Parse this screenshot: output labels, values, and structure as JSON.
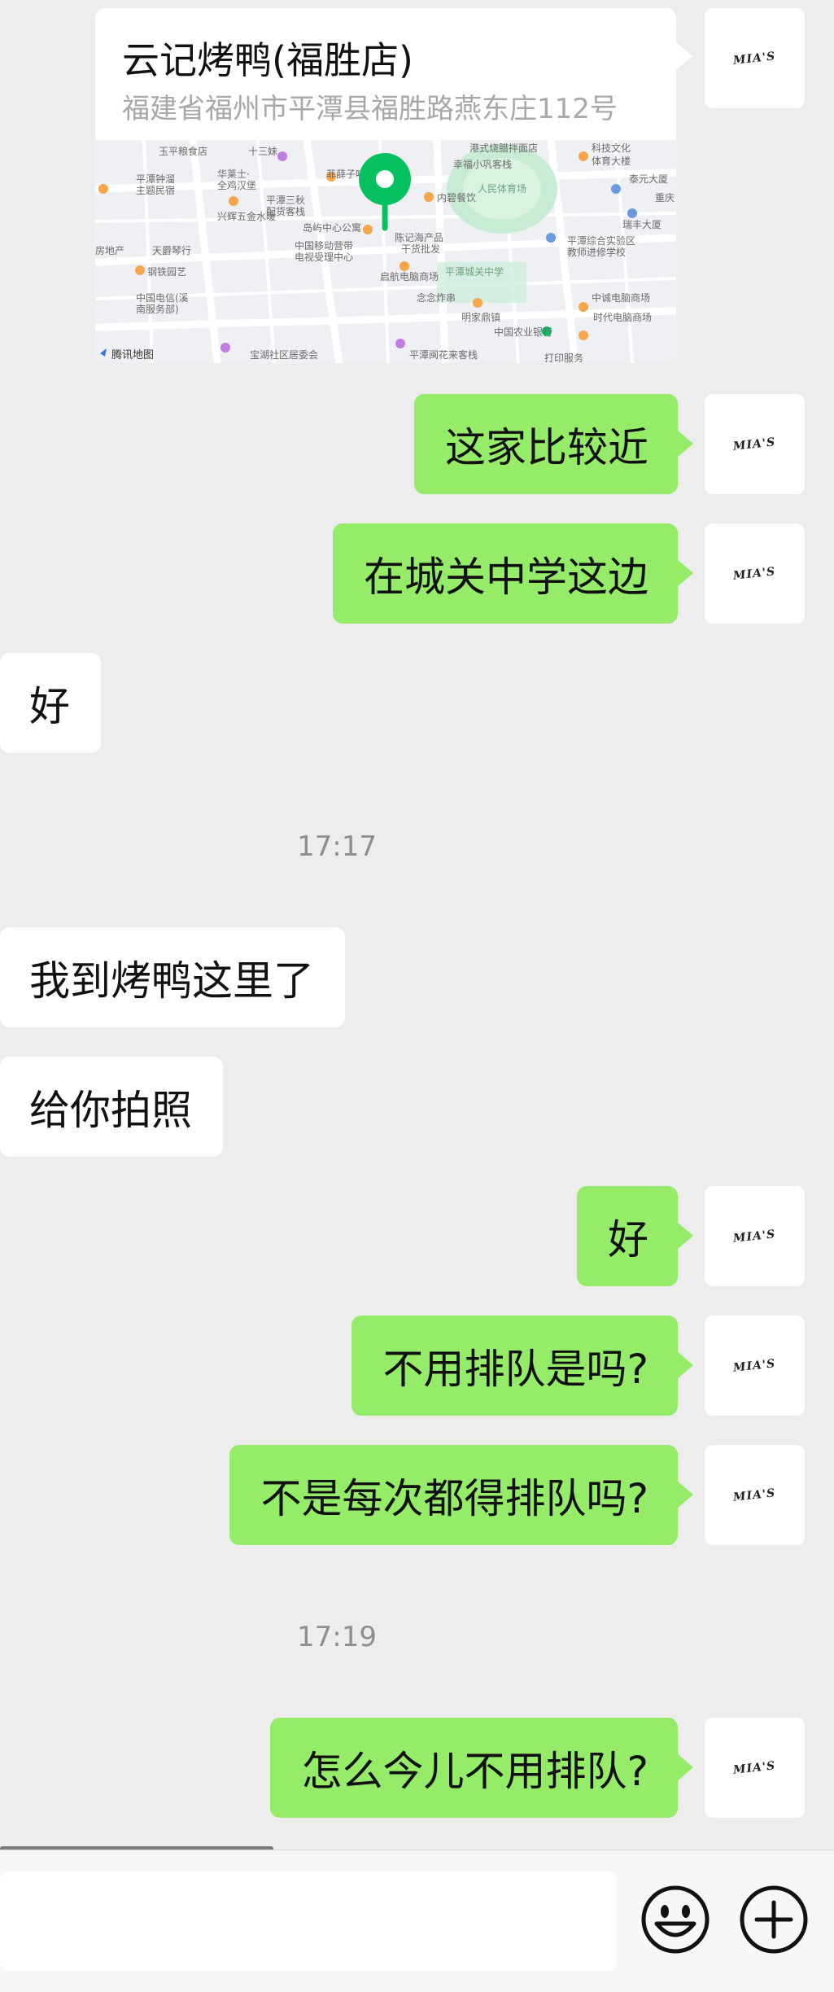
{
  "location": {
    "title": "云记烤鸭(福胜店)",
    "address": "福建省福州市平潭县福胜路燕东庄112号",
    "map_attribution": "腾讯地图",
    "map_labels": [
      "玉平粮食店",
      "十三妹",
      "港式烧腊拌面店",
      "科技文化",
      "体育大楼",
      "幸福小巩客栈",
      "泰元大厦",
      "平潭钟溜",
      "主题民宿",
      "华莱士·",
      "全鸡汉堡",
      "菲薛子听酒馆",
      "内碧餐饮",
      "人民体育场",
      "重庆",
      "平潭三秋",
      "配货客栈",
      "瑞丰大厦",
      "兴辉五金水暖",
      "岛屿中心公寓",
      "陈记海产品",
      "干货批发",
      "平潭综合实验区",
      "教师进修学校",
      "中国移动营带",
      "电视受理中心",
      "启航电脑商场",
      "平潭城关中学",
      "房地产",
      "天爵琴行",
      "钢铁园艺",
      "念念炸串",
      "中诚电脑商场",
      "中国电信(溪",
      "南服务部)",
      "明家鼎镇",
      "中国农业银行",
      "时代电脑商场",
      "宝湖社区居委会",
      "平潭闽花来客栈",
      "打印服务"
    ]
  },
  "messages": [
    {
      "text": "这家比较近"
    },
    {
      "text": "在城关中学这边"
    },
    {
      "text": "好"
    },
    {
      "text": "我到烤鸭这里了"
    },
    {
      "text": "给你拍照"
    },
    {
      "text": "好"
    },
    {
      "text": "不用排队是吗?"
    },
    {
      "text": "不是每次都得排队吗?"
    },
    {
      "text": "怎么今儿不用排队?"
    }
  ],
  "timestamps": [
    "17:17",
    "17:19"
  ],
  "avatar": {
    "label": "MIA'S"
  },
  "colors": {
    "outgoing_bubble": "#95ec69",
    "incoming_bubble": "#ffffff",
    "background": "#ededed",
    "map_pin": "#07c160"
  },
  "icons": {
    "emoji": "emoji-icon",
    "more": "plus-icon"
  }
}
